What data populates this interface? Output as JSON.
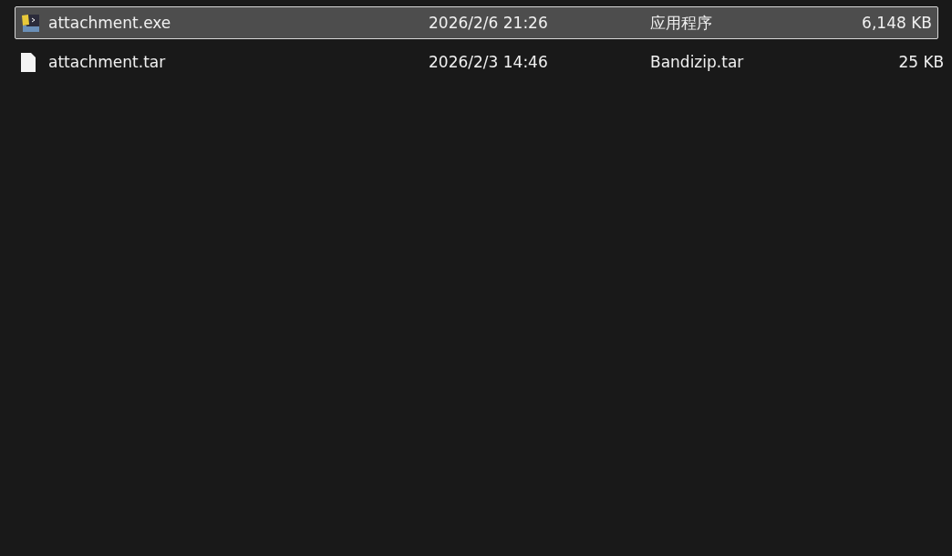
{
  "files": [
    {
      "name": "attachment.exe",
      "kind": "exe",
      "modified": "2026/2/6 21:26",
      "type": "应用程序",
      "size": "6,148 KB",
      "selected": true
    },
    {
      "name": "attachment.tar",
      "kind": "file",
      "modified": "2026/2/3 14:46",
      "type": "Bandizip.tar",
      "size": "25 KB",
      "selected": false
    }
  ]
}
